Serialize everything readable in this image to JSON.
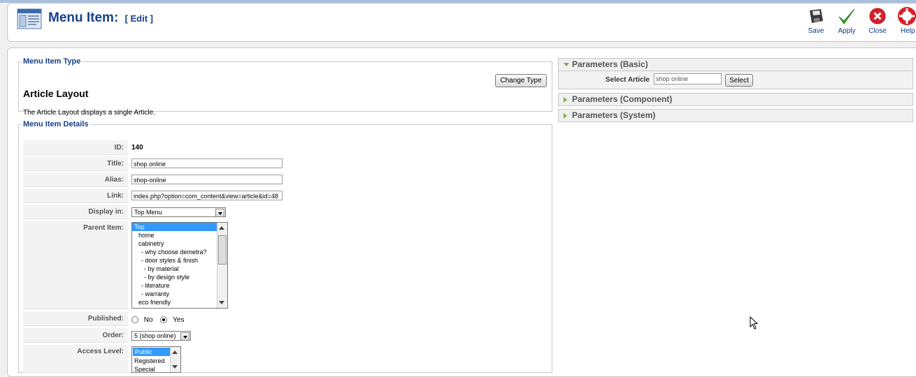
{
  "header": {
    "title": "Menu Item:",
    "subtitle": "[ Edit ]"
  },
  "toolbar": {
    "save_label": "Save",
    "apply_label": "Apply",
    "close_label": "Close",
    "help_label": "Help"
  },
  "menu_item_type": {
    "legend": "Menu Item Type",
    "name": "Article Layout",
    "description": "The Article Layout displays a single Article.",
    "change_type_label": "Change Type"
  },
  "details": {
    "legend": "Menu Item Details",
    "id_label": "ID:",
    "id_value": "140",
    "title_label": "Title:",
    "title_value": "shop online",
    "alias_label": "Alias:",
    "alias_value": "shop-online",
    "link_label": "Link:",
    "link_value": "index.php?option=com_content&view=article&id=48",
    "display_in_label": "Display in:",
    "display_in_value": "Top Menu",
    "parent_label": "Parent Item:",
    "parent_items": [
      "Top",
      "home",
      "cabinetry",
      "- why choose demetra?",
      "- door styles & finish",
      "- by material",
      "- by design style",
      "- literature",
      "- warranty",
      "eco friendly"
    ],
    "published_label": "Published:",
    "published_no": "No",
    "published_yes": "Yes",
    "order_label": "Order:",
    "order_value": "5 (shop online)",
    "access_label": "Access Level:",
    "access_items": [
      "Public",
      "Registered",
      "Special"
    ]
  },
  "params": {
    "basic_title": "Parameters (Basic)",
    "select_article_label": "Select Article",
    "select_article_value": "shop online",
    "select_button_label": "Select",
    "component_title": "Parameters (Component)",
    "system_title": "Parameters (System)"
  },
  "colors": {
    "title_blue": "#15408a",
    "selection_blue": "#3399ff",
    "panel_arrow_green": "#7ab04a"
  }
}
